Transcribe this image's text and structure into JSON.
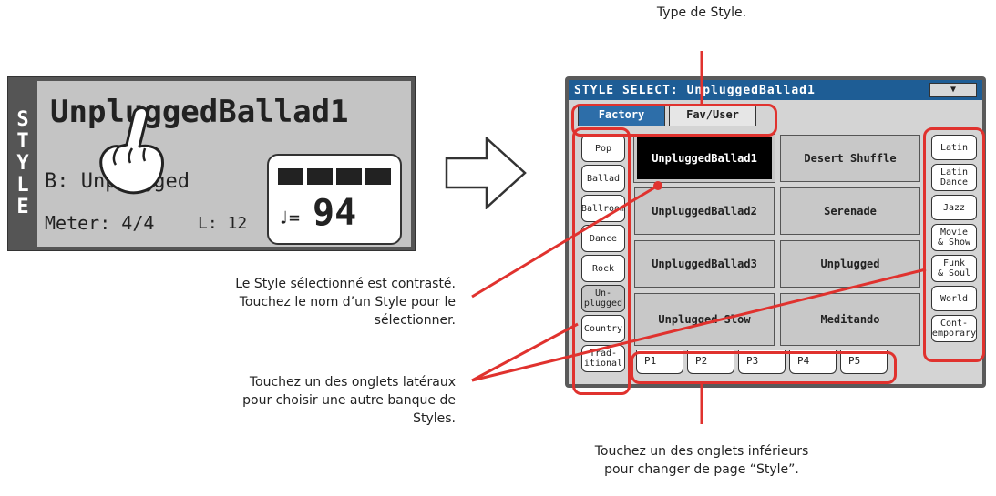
{
  "annotations": {
    "style_type": "Type de Style.",
    "selected_style": [
      "Le Style sélectionné est contrasté.",
      "Touchez le nom d’un Style pour le",
      "sélectionner."
    ],
    "side_tabs": [
      "Touchez un des onglets latéraux",
      "pour choisir une autre banque de",
      "Styles."
    ],
    "bottom_tabs": [
      "Touchez un des onglets inférieurs",
      "pour changer de page “Style”."
    ]
  },
  "style_panel": {
    "vertical_label": [
      "S",
      "T",
      "Y",
      "L",
      "E"
    ],
    "style_name": "UnpluggedBallad1",
    "bank": "B: Unplugged",
    "meter": "Meter:  4/4",
    "length": "L:  12",
    "tempo_symbol": "♩=",
    "tempo": "94"
  },
  "screen": {
    "title": "STYLE SELECT: UnpluggedBallad1",
    "dropdown_icon": "▼",
    "top_tabs": [
      {
        "label": "Factory",
        "active": true
      },
      {
        "label": "Fav/User",
        "active": false
      }
    ],
    "left_tabs": [
      "Pop",
      "Ballad",
      "Ballroom",
      "Dance",
      "Rock",
      "Un-\nplugged",
      "Country",
      "Trad-\nitional"
    ],
    "right_tabs": [
      "Latin",
      "Latin\nDance",
      "Jazz",
      "Movie\n& Show",
      "Funk\n& Soul",
      "World",
      "Cont-\nemporary"
    ],
    "styles": [
      [
        "UnpluggedBallad1",
        "Desert Shuffle"
      ],
      [
        "UnpluggedBallad2",
        "Serenade"
      ],
      [
        "UnpluggedBallad3",
        "Unplugged"
      ],
      [
        "Unplugged Slow",
        "Meditando"
      ]
    ],
    "pages": [
      "P1",
      "P2",
      "P3",
      "P4",
      "P5"
    ]
  },
  "colors": {
    "highlight": "#e0322e",
    "title_bar": "#1e5d95",
    "active_tab": "#2d6ea9"
  }
}
